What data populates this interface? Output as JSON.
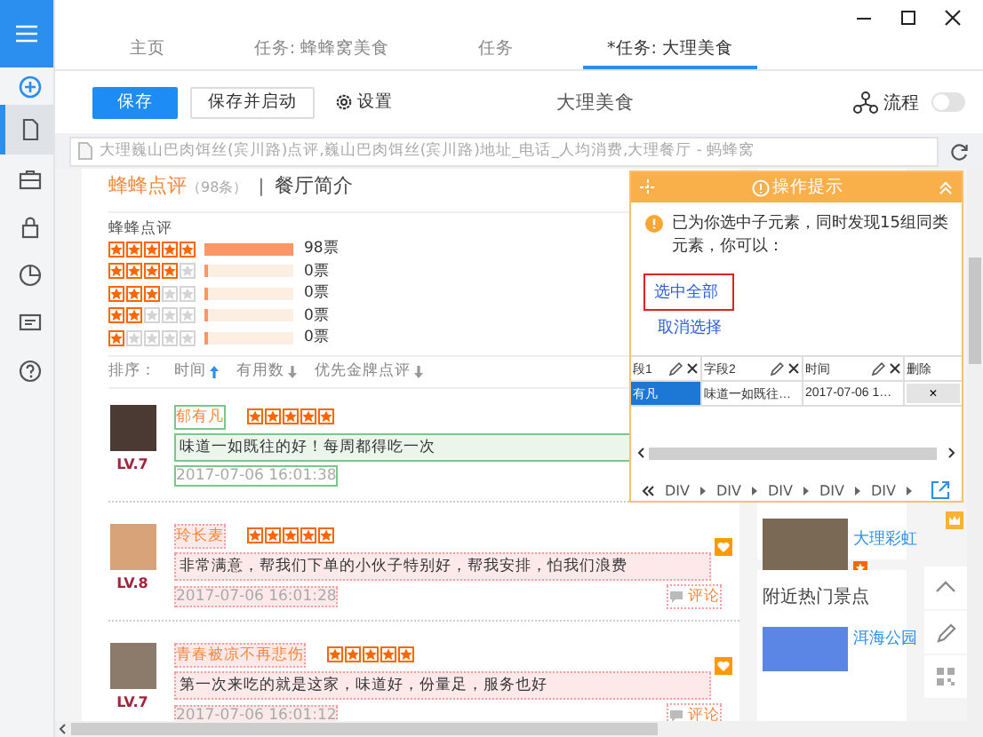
{
  "sidebar": {
    "items": [
      {
        "selected": false
      },
      {
        "selected": true
      },
      {
        "selected": false
      },
      {
        "selected": false
      },
      {
        "selected": false
      },
      {
        "selected": false
      },
      {
        "selected": false
      }
    ]
  },
  "tabs": [
    {
      "label": "主页",
      "selected": false
    },
    {
      "label": "任务: 蜂蜂窝美食",
      "selected": false
    },
    {
      "label": "任务",
      "selected": false
    },
    {
      "label": "*任务: 大理美食",
      "selected": true
    }
  ],
  "toolbar": {
    "save": "保存",
    "save_and_start": "保存并启动",
    "settings": "设置",
    "task_name": "大理美食",
    "flow": {
      "label": "流程",
      "on": false
    }
  },
  "address_bar": {
    "value": "大理巍山巴肉饵丝(宾川路)点评,巍山巴肉饵丝(宾川路)地址_电话_人均消费,大理餐厅 - 蚂蜂窝"
  },
  "reviews_section": {
    "title": "蜂蜂点评",
    "count": "（98条）",
    "separator": "|",
    "other_tab": "餐厅简介",
    "rating_label": "蜂蜂点评",
    "ratings": [
      {
        "stars": 5,
        "level": 1,
        "count": "98票"
      },
      {
        "stars": 4,
        "level": 0,
        "count": "0票"
      },
      {
        "stars": 3,
        "level": 0,
        "count": "0票"
      },
      {
        "stars": 2,
        "level": 0,
        "count": "0票"
      },
      {
        "stars": 1,
        "level": 0,
        "count": "0票"
      }
    ],
    "sort_label": "排序：",
    "sort_options": [
      {
        "label": "时间",
        "selected": true
      },
      {
        "label": "有用数",
        "selected": false
      },
      {
        "label": "优先金牌点评",
        "selected": false
      }
    ],
    "reviews": [
      {
        "user": "郁有凡",
        "level": "LV.7",
        "stars": 5,
        "text": "味道一如既往的好！每周都得吃一次",
        "time": "2017-07-06 16:01:38",
        "selected": true
      },
      {
        "user": "玲长麦",
        "level": "LV.8",
        "stars": 5,
        "text": "非常满意，帮我们下单的小伙子特别好，帮我安排，怕我们浪费",
        "time": "2017-07-06 16:01:28",
        "selected": false,
        "reply_label": "评论"
      },
      {
        "user": "青春被凉不再悲伤",
        "level": "LV.7",
        "stars": 5,
        "text": "第一次来吃的就是这家，味道好，份量足，服务也好",
        "time": "2017-07-06 16:01:12",
        "selected": false,
        "reply_label": "评论"
      }
    ]
  },
  "side_column": {
    "shop_link": "大理彩虹",
    "nearby_title": "附近热门景点",
    "nearby_link": "洱海公园"
  },
  "popup": {
    "title": "操作提示",
    "message": "已为你选中子元素，同时发现15组同类元素，你可以：",
    "select_all": "选中全部",
    "deselect": "取消选择",
    "columns": [
      {
        "label": "段1",
        "editable": true
      },
      {
        "label": "字段2",
        "editable": true
      },
      {
        "label": "时间",
        "editable": true
      },
      {
        "label": "删除",
        "editable": false
      }
    ],
    "row": {
      "cells": [
        "有凡",
        "味道一如既往…",
        "2017-07-06 1…"
      ],
      "delete": "×"
    },
    "breadcrumbs": [
      "DIV",
      "DIV",
      "DIV",
      "DIV",
      "DIV"
    ]
  }
}
